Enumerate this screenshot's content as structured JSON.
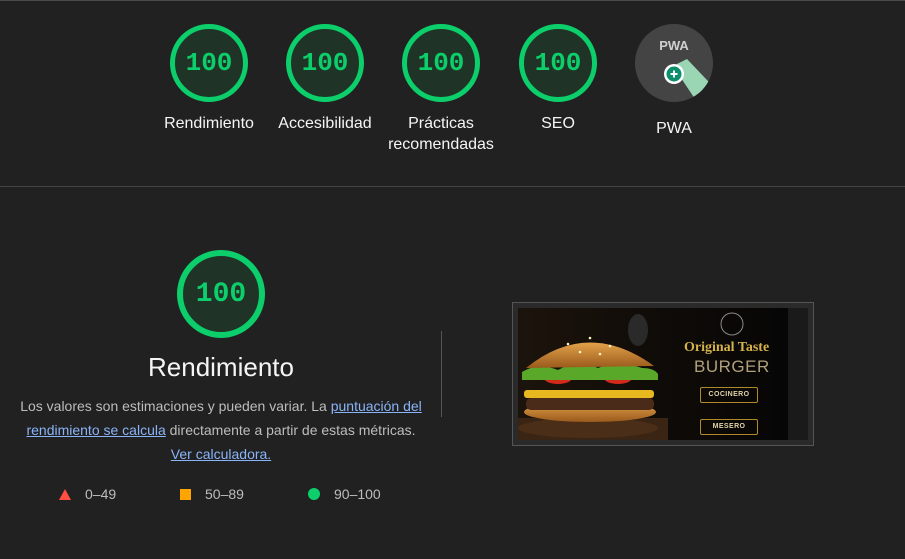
{
  "categories": [
    {
      "label": "Rendimiento",
      "score": "100"
    },
    {
      "label": "Accesibilidad",
      "score": "100"
    },
    {
      "label": "Prácticas recomendadas",
      "score": "100"
    },
    {
      "label": "SEO",
      "score": "100"
    },
    {
      "label": "PWA",
      "badge": "PWA"
    }
  ],
  "performance": {
    "score": "100",
    "title": "Rendimiento",
    "desc_prefix": "Los valores son estimaciones y pueden variar. La ",
    "desc_link": "puntuación del rendimiento se calcula",
    "desc_middle": " directamente a partir de estas métricas. ",
    "calc_link": "Ver calculadora."
  },
  "legend": [
    {
      "range": "0–49",
      "color": "#ff4e42"
    },
    {
      "range": "50–89",
      "color": "#ffa400"
    },
    {
      "range": "90–100",
      "color": "#0cce6b"
    }
  ],
  "screenshot": {
    "title_line1": "Original Taste",
    "title_line2": "BURGER",
    "button1": "COCINERO",
    "button2": "MESERO"
  },
  "colors": {
    "pass": "#0cce6b",
    "average": "#ffa400",
    "fail": "#ff4e42",
    "link": "#8ab4f8"
  }
}
